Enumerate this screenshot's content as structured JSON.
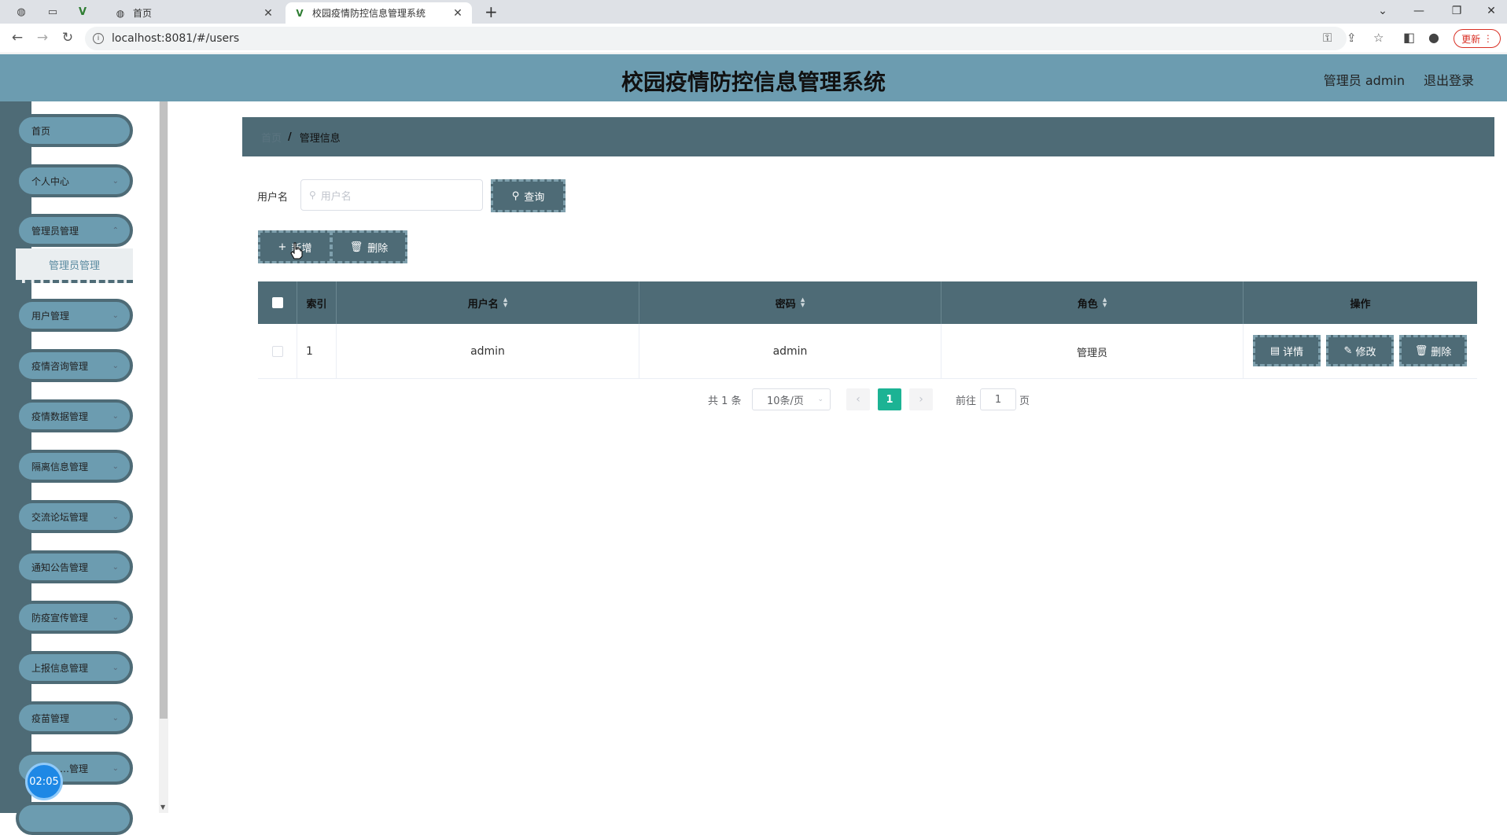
{
  "browser": {
    "tabs": [
      {
        "title": "首页"
      },
      {
        "title": "校园疫情防控信息管理系统"
      }
    ],
    "url": "localhost:8081/#/users",
    "update_label": "更新"
  },
  "header": {
    "title": "校园疫情防控信息管理系统",
    "user": "管理员 admin",
    "logout": "退出登录"
  },
  "sidebar": {
    "items": [
      {
        "label": "首页"
      },
      {
        "label": "个人中心"
      },
      {
        "label": "管理员管理"
      },
      {
        "label": "用户管理"
      },
      {
        "label": "疫情咨询管理"
      },
      {
        "label": "疫情数据管理"
      },
      {
        "label": "隔离信息管理"
      },
      {
        "label": "交流论坛管理"
      },
      {
        "label": "通知公告管理"
      },
      {
        "label": "防疫宣传管理"
      },
      {
        "label": "上报信息管理"
      },
      {
        "label": "疫苗管理"
      },
      {
        "label": "…管理"
      }
    ],
    "submenu_label": "管理员管理",
    "timer": "02:05"
  },
  "breadcrumb": {
    "home": "首页",
    "sep": "/",
    "current": "管理信息"
  },
  "search": {
    "label": "用户名",
    "placeholder": "用户名",
    "button": "查询"
  },
  "actions": {
    "add": "新增",
    "delete": "删除"
  },
  "table": {
    "columns": [
      "索引",
      "用户名",
      "密码",
      "角色",
      "操作"
    ],
    "rows": [
      {
        "index": "1",
        "username": "admin",
        "password": "admin",
        "role": "管理员"
      }
    ],
    "row_actions": {
      "detail": "详情",
      "edit": "修改",
      "delete": "删除"
    }
  },
  "pagination": {
    "total": "共 1 条",
    "page_size": "10条/页",
    "current": "1",
    "goto_label": "前往",
    "goto_value": "1",
    "page_suffix": "页"
  },
  "colors": {
    "header": "#6c9cb0",
    "dark": "#4e6b76",
    "accent": "#1cb394"
  }
}
